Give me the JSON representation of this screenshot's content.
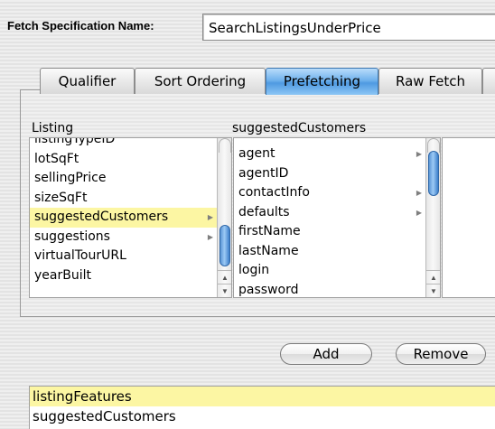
{
  "header": {
    "label": "Fetch Specification Name:",
    "name_value": "SearchListingsUnderPrice"
  },
  "tabs": [
    {
      "label": "Qualifier",
      "active": false
    },
    {
      "label": "Sort Ordering",
      "active": false
    },
    {
      "label": "Prefetching",
      "active": true
    },
    {
      "label": "Raw Fetch",
      "active": false
    }
  ],
  "browser": {
    "column_headers": [
      "Listing",
      "suggestedCustomers"
    ],
    "column1": [
      {
        "label": "listingTypeID",
        "selected": false,
        "has_children": false
      },
      {
        "label": "lotSqFt",
        "selected": false,
        "has_children": false
      },
      {
        "label": "sellingPrice",
        "selected": false,
        "has_children": false
      },
      {
        "label": "sizeSqFt",
        "selected": false,
        "has_children": false
      },
      {
        "label": "suggestedCustomers",
        "selected": true,
        "has_children": true
      },
      {
        "label": "suggestions",
        "selected": false,
        "has_children": true
      },
      {
        "label": "virtualTourURL",
        "selected": false,
        "has_children": false
      },
      {
        "label": "yearBuilt",
        "selected": false,
        "has_children": false
      }
    ],
    "column2": [
      {
        "label": "agent",
        "selected": false,
        "has_children": true
      },
      {
        "label": "agentID",
        "selected": false,
        "has_children": false
      },
      {
        "label": "contactInfo",
        "selected": false,
        "has_children": true
      },
      {
        "label": "defaults",
        "selected": false,
        "has_children": true
      },
      {
        "label": "firstName",
        "selected": false,
        "has_children": false
      },
      {
        "label": "lastName",
        "selected": false,
        "has_children": false
      },
      {
        "label": "login",
        "selected": false,
        "has_children": false
      },
      {
        "label": "password",
        "selected": false,
        "has_children": false
      }
    ],
    "arrow_glyph": "▶",
    "scroll_up_glyph": "▲",
    "scroll_down_glyph": "▼"
  },
  "buttons": {
    "add_label": "Add",
    "remove_label": "Remove"
  },
  "prefetch_keys": [
    {
      "label": "listingFeatures",
      "selected": true
    },
    {
      "label": "suggestedCustomers",
      "selected": false
    }
  ],
  "colors": {
    "selection": "#fcf6a3",
    "active_tab": "#6fb1ec",
    "scroll_thumb": "#5a95d5"
  }
}
